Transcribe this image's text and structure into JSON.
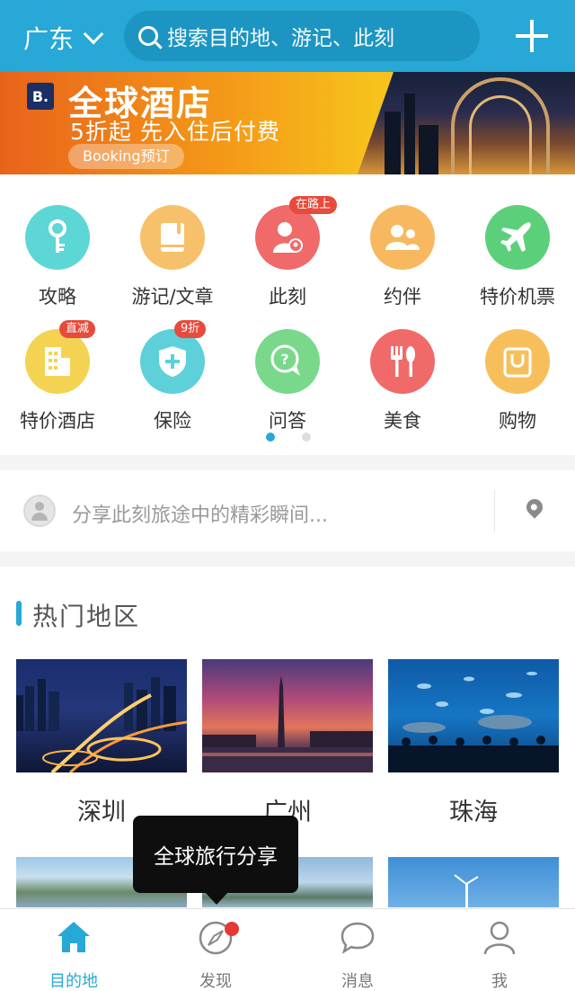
{
  "header": {
    "city": "广东",
    "search_placeholder": "搜索目的地、游记、此刻",
    "icons": [
      "chevron-down-icon",
      "search-icon",
      "plus-icon"
    ]
  },
  "banner": {
    "logo_letter": "B.",
    "title": "全球酒店",
    "subtitle": "5折起 先入住后付费",
    "tag": "Booking预订"
  },
  "quick_menu": {
    "items": [
      {
        "label": "攻略",
        "color": "#5dd6d6",
        "icon": "key-icon"
      },
      {
        "label": "游记/文章",
        "color": "#f7c06a",
        "icon": "book-icon"
      },
      {
        "label": "此刻",
        "color": "#f06a6a",
        "icon": "person-pin-icon",
        "badge": "在路上"
      },
      {
        "label": "约伴",
        "color": "#f7b860",
        "icon": "people-icon"
      },
      {
        "label": "特价机票",
        "color": "#5ccf7a",
        "icon": "airplane-icon"
      },
      {
        "label": "特价酒店",
        "color": "#f4d352",
        "icon": "building-icon",
        "badge": "直减"
      },
      {
        "label": "保险",
        "color": "#5dd0da",
        "icon": "shield-icon",
        "badge": "9折"
      },
      {
        "label": "问答",
        "color": "#79d88a",
        "icon": "question-bubble-icon"
      },
      {
        "label": "美食",
        "color": "#f06a6a",
        "icon": "fork-knife-icon"
      },
      {
        "label": "购物",
        "color": "#f7bf5c",
        "icon": "shopping-bag-icon"
      }
    ],
    "page_count": 2,
    "active_page": 1
  },
  "share_bar": {
    "placeholder": "分享此刻旅途中的精彩瞬间...",
    "icons": [
      "avatar-icon",
      "location-pin-icon"
    ]
  },
  "hot_regions": {
    "title": "热门地区",
    "cities": [
      "深圳",
      "广州",
      "珠海"
    ]
  },
  "tooltip": {
    "text": "全球旅行分享"
  },
  "tabbar": {
    "tabs": [
      {
        "label": "目的地",
        "icon": "home-icon",
        "active": true
      },
      {
        "label": "发现",
        "icon": "compass-icon",
        "has_dot": true
      },
      {
        "label": "消息",
        "icon": "chat-bubble-icon"
      },
      {
        "label": "我",
        "icon": "user-icon"
      }
    ],
    "accent": "#27a8d6"
  }
}
